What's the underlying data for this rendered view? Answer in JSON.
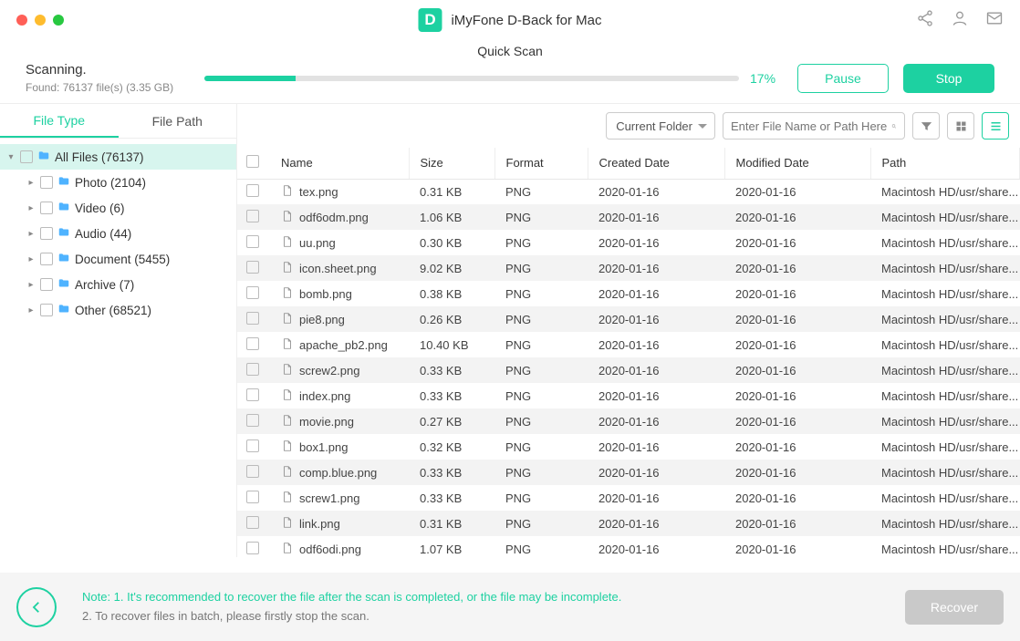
{
  "title": "iMyFone D-Back for Mac",
  "scan": {
    "modeTitle": "Quick Scan",
    "status": "Scanning.",
    "found": "Found: 76137 file(s) (3.35 GB)",
    "pct": "17%",
    "pctValue": 17,
    "pauseLabel": "Pause",
    "stopLabel": "Stop"
  },
  "tabs": {
    "fileType": "File Type",
    "filePath": "File Path"
  },
  "tree": [
    {
      "label": "All Files (76137)",
      "level": 0,
      "caret": "down",
      "selected": true
    },
    {
      "label": "Photo (2104)",
      "level": 1,
      "caret": "right"
    },
    {
      "label": "Video (6)",
      "level": 1,
      "caret": "right"
    },
    {
      "label": "Audio (44)",
      "level": 1,
      "caret": "right"
    },
    {
      "label": "Document (5455)",
      "level": 1,
      "caret": "right"
    },
    {
      "label": "Archive (7)",
      "level": 1,
      "caret": "right"
    },
    {
      "label": "Other (68521)",
      "level": 1,
      "caret": "right"
    }
  ],
  "toolbar": {
    "folderSelect": "Current Folder",
    "searchPlaceholder": "Enter File Name or Path Here"
  },
  "cols": {
    "name": "Name",
    "size": "Size",
    "format": "Format",
    "created": "Created Date",
    "modified": "Modified Date",
    "path": "Path"
  },
  "rows": [
    {
      "name": "tex.png",
      "size": "0.31 KB",
      "format": "PNG",
      "created": "2020-01-16",
      "modified": "2020-01-16",
      "path": "Macintosh HD/usr/share..."
    },
    {
      "name": "odf6odm.png",
      "size": "1.06 KB",
      "format": "PNG",
      "created": "2020-01-16",
      "modified": "2020-01-16",
      "path": "Macintosh HD/usr/share..."
    },
    {
      "name": "uu.png",
      "size": "0.30 KB",
      "format": "PNG",
      "created": "2020-01-16",
      "modified": "2020-01-16",
      "path": "Macintosh HD/usr/share..."
    },
    {
      "name": "icon.sheet.png",
      "size": "9.02 KB",
      "format": "PNG",
      "created": "2020-01-16",
      "modified": "2020-01-16",
      "path": "Macintosh HD/usr/share..."
    },
    {
      "name": "bomb.png",
      "size": "0.38 KB",
      "format": "PNG",
      "created": "2020-01-16",
      "modified": "2020-01-16",
      "path": "Macintosh HD/usr/share..."
    },
    {
      "name": "pie8.png",
      "size": "0.26 KB",
      "format": "PNG",
      "created": "2020-01-16",
      "modified": "2020-01-16",
      "path": "Macintosh HD/usr/share..."
    },
    {
      "name": "apache_pb2.png",
      "size": "10.40 KB",
      "format": "PNG",
      "created": "2020-01-16",
      "modified": "2020-01-16",
      "path": "Macintosh HD/usr/share..."
    },
    {
      "name": "screw2.png",
      "size": "0.33 KB",
      "format": "PNG",
      "created": "2020-01-16",
      "modified": "2020-01-16",
      "path": "Macintosh HD/usr/share..."
    },
    {
      "name": "index.png",
      "size": "0.33 KB",
      "format": "PNG",
      "created": "2020-01-16",
      "modified": "2020-01-16",
      "path": "Macintosh HD/usr/share..."
    },
    {
      "name": "movie.png",
      "size": "0.27 KB",
      "format": "PNG",
      "created": "2020-01-16",
      "modified": "2020-01-16",
      "path": "Macintosh HD/usr/share..."
    },
    {
      "name": "box1.png",
      "size": "0.32 KB",
      "format": "PNG",
      "created": "2020-01-16",
      "modified": "2020-01-16",
      "path": "Macintosh HD/usr/share..."
    },
    {
      "name": "comp.blue.png",
      "size": "0.33 KB",
      "format": "PNG",
      "created": "2020-01-16",
      "modified": "2020-01-16",
      "path": "Macintosh HD/usr/share..."
    },
    {
      "name": "screw1.png",
      "size": "0.33 KB",
      "format": "PNG",
      "created": "2020-01-16",
      "modified": "2020-01-16",
      "path": "Macintosh HD/usr/share..."
    },
    {
      "name": "link.png",
      "size": "0.31 KB",
      "format": "PNG",
      "created": "2020-01-16",
      "modified": "2020-01-16",
      "path": "Macintosh HD/usr/share..."
    },
    {
      "name": "odf6odi.png",
      "size": "1.07 KB",
      "format": "PNG",
      "created": "2020-01-16",
      "modified": "2020-01-16",
      "path": "Macintosh HD/usr/share..."
    }
  ],
  "footer": {
    "note1": "Note: 1. It's recommended to recover the file after the scan is completed, or the file may be incomplete.",
    "note2": "2. To recover files in batch, please firstly stop the scan.",
    "recover": "Recover"
  }
}
